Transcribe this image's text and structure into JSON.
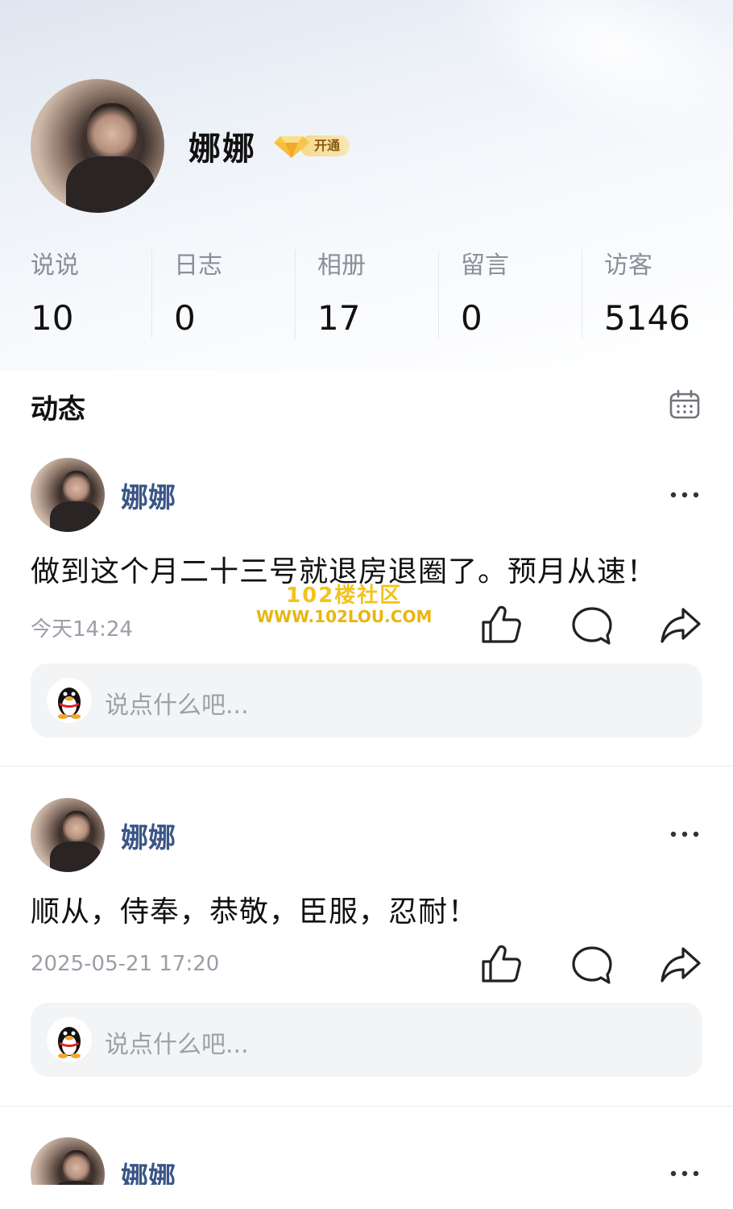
{
  "profile": {
    "name": "娜娜",
    "vip_label": "开通"
  },
  "stats": [
    {
      "label": "说说",
      "value": "10"
    },
    {
      "label": "日志",
      "value": "0"
    },
    {
      "label": "相册",
      "value": "17"
    },
    {
      "label": "留言",
      "value": "0"
    },
    {
      "label": "访客",
      "value": "5146"
    }
  ],
  "section": {
    "title": "动态",
    "icon": "calendar-icon"
  },
  "posts": [
    {
      "author": "娜娜",
      "text": "做到这个月二十三号就退房退圈了。预月从速！",
      "time": "今天14:24",
      "comment_placeholder": "说点什么吧..."
    },
    {
      "author": "娜娜",
      "text": "顺从，侍奉，恭敬，臣服，忍耐！",
      "time": "2025-05-21 17:20",
      "comment_placeholder": "说点什么吧..."
    },
    {
      "author": "娜娜"
    }
  ],
  "watermark": {
    "title": "102楼社区",
    "url": "WWW.102LOU.COM"
  },
  "colors": {
    "author_name": "#3b5587",
    "muted_text": "#9a9ea6",
    "vip_gold": "#f6d98b"
  }
}
